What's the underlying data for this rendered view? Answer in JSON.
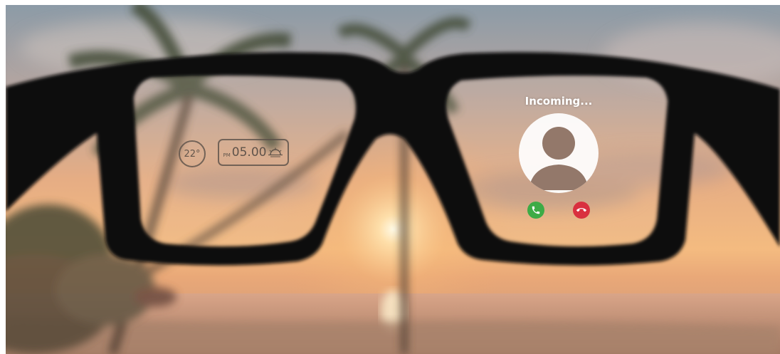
{
  "scene": {
    "description_colors": {
      "sky_top": "#8a9aa6",
      "sky_mid": "#d8a98a",
      "sky_horizon": "#f4b87a",
      "sun": "#fff6dc",
      "sea": "#b88a6c",
      "frame": "#0a0807",
      "lens_tint": "#d9b9a0"
    }
  },
  "left_lens_hud": {
    "temperature": "22°",
    "time_prefix": "PM",
    "time": "05.00",
    "sunset_icon": "sunset-icon"
  },
  "right_lens_hud": {
    "call_status": "Incoming...",
    "avatar_icon": "person-icon",
    "accept_icon": "phone-accept-icon",
    "decline_icon": "phone-decline-icon",
    "accept_color": "#3dab46",
    "decline_color": "#d9303f"
  }
}
